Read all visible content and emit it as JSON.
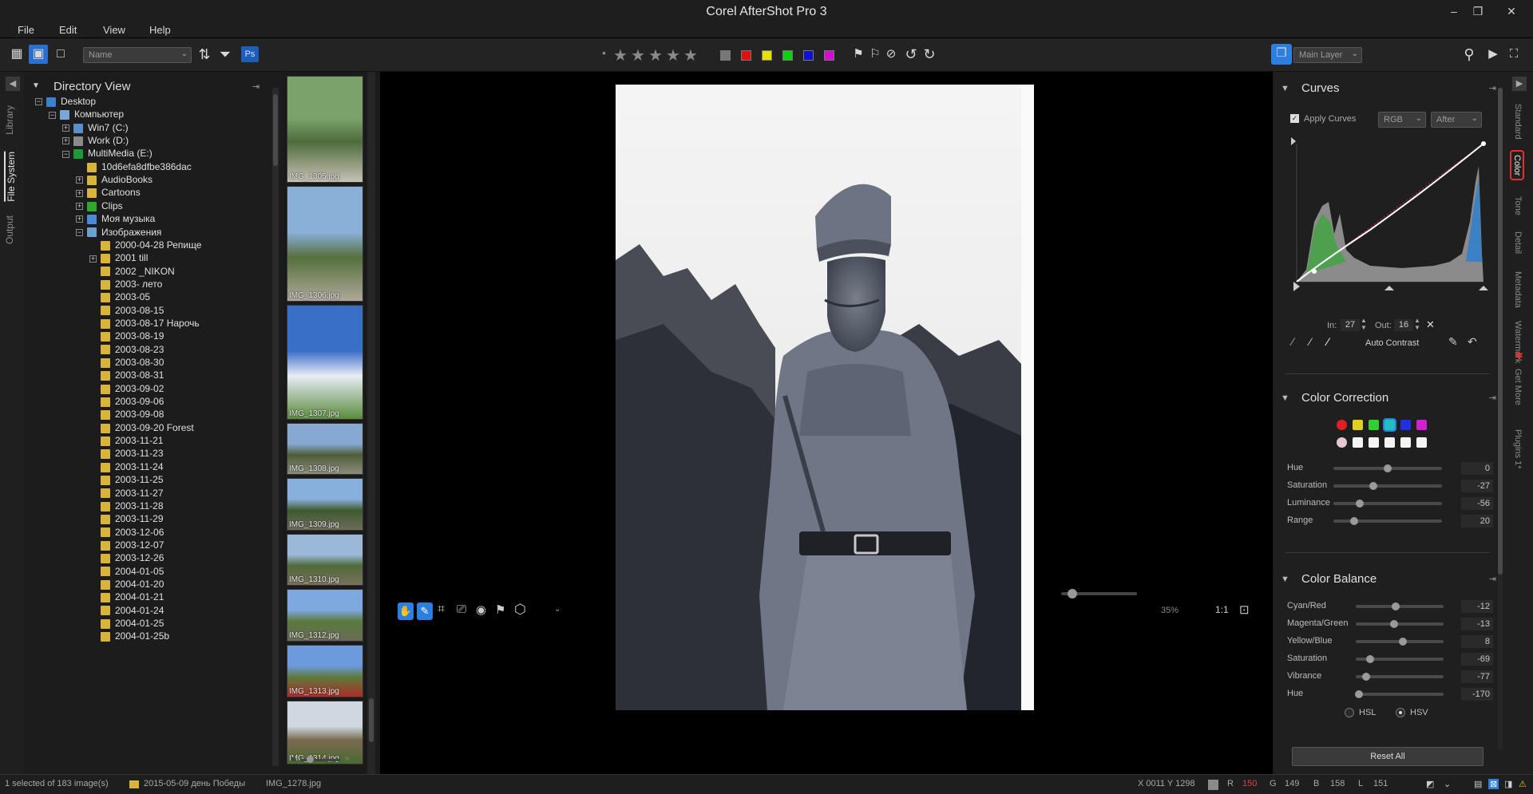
{
  "window": {
    "title": "Corel AfterShot Pro 3"
  },
  "menu": [
    "File",
    "Edit",
    "View",
    "Help"
  ],
  "toolbar": {
    "sort_select": "Name",
    "ps_badge": "Ps",
    "layer_select": "Main Layer",
    "rating_dot": "•"
  },
  "left_tabs": [
    "Library",
    "File System",
    "Output"
  ],
  "directory": {
    "title": "Directory View",
    "items": [
      "Desktop",
      "Компьютер",
      "Win7 (C:)",
      "Work (D:)",
      "MultiMedia (E:)",
      "10d6efa8dfbe386dac",
      "AudioBooks",
      "Cartoons",
      "Clips",
      "Моя музыка",
      "Изображения",
      "2000-04-28 Репище",
      "2001 till",
      "2002 _NIKON",
      "2003- лето",
      "2003-05",
      "2003-08-15",
      "2003-08-17 Нарочь",
      "2003-08-19",
      "2003-08-23",
      "2003-08-30",
      "2003-08-31",
      "2003-09-02",
      "2003-09-06",
      "2003-09-08",
      "2003-09-20 Forest",
      "2003-11-21",
      "2003-11-23",
      "2003-11-24",
      "2003-11-25",
      "2003-11-27",
      "2003-11-28",
      "2003-11-29",
      "2003-12-06",
      "2003-12-07",
      "2003-12-26",
      "2004-01-05",
      "2004-01-20",
      "2004-01-21",
      "2004-01-24",
      "2004-01-25",
      "2004-01-25b"
    ]
  },
  "thumbs": [
    "IMG_1305.jpg",
    "IMG_1306.jpg",
    "IMG_1307.jpg",
    "IMG_1308.jpg",
    "IMG_1309.jpg",
    "IMG_1310.jpg",
    "IMG_1312.jpg",
    "IMG_1313.jpg",
    "IMG_1314.jpg"
  ],
  "viewer": {
    "zoom": "35%"
  },
  "curves": {
    "title": "Curves",
    "apply_label": "Apply Curves",
    "channel": "RGB",
    "mode": "After",
    "in_label": "In:",
    "in_value": "27",
    "out_label": "Out:",
    "out_value": "16",
    "auto_contrast": "Auto Contrast"
  },
  "color_correction": {
    "title": "Color Correction",
    "swatches": [
      "#e02020",
      "#e0d020",
      "#30d030",
      "#20c0c0",
      "#2030e0",
      "#d020d0"
    ],
    "sliders": [
      {
        "label": "Hue",
        "value": "0",
        "pos": 0.5
      },
      {
        "label": "Saturation",
        "value": "-27",
        "pos": 0.37
      },
      {
        "label": "Luminance",
        "value": "-56",
        "pos": 0.24
      },
      {
        "label": "Range",
        "value": "20",
        "pos": 0.19
      }
    ]
  },
  "color_balance": {
    "title": "Color Balance",
    "sliders": [
      {
        "label": "Cyan/Red",
        "value": "-12",
        "pos": 0.45
      },
      {
        "label": "Magenta/Green",
        "value": "-13",
        "pos": 0.44
      },
      {
        "label": "Yellow/Blue",
        "value": "8",
        "pos": 0.54
      },
      {
        "label": "Saturation",
        "value": "-69",
        "pos": 0.16
      },
      {
        "label": "Vibrance",
        "value": "-77",
        "pos": 0.12
      },
      {
        "label": "Hue",
        "value": "-170",
        "pos": 0.04
      }
    ],
    "hsl": "HSL",
    "hsv": "HSV"
  },
  "reset_all": "Reset All",
  "right_tabs": [
    "Standard",
    "Color",
    "Tone",
    "Detail",
    "Metadata",
    "Watermark",
    "Get More",
    "Plugins 1*"
  ],
  "status": {
    "selection": "1 selected of 183 image(s)",
    "folder": "2015-05-09 день Победы",
    "file": "IMG_1278.jpg",
    "coords": "X 0011  Y 1298",
    "r_label": "R",
    "r_value": "150",
    "g_label": "G",
    "g_value": "149",
    "b_label": "B",
    "b_value": "158",
    "l_label": "L",
    "l_value": "151"
  }
}
